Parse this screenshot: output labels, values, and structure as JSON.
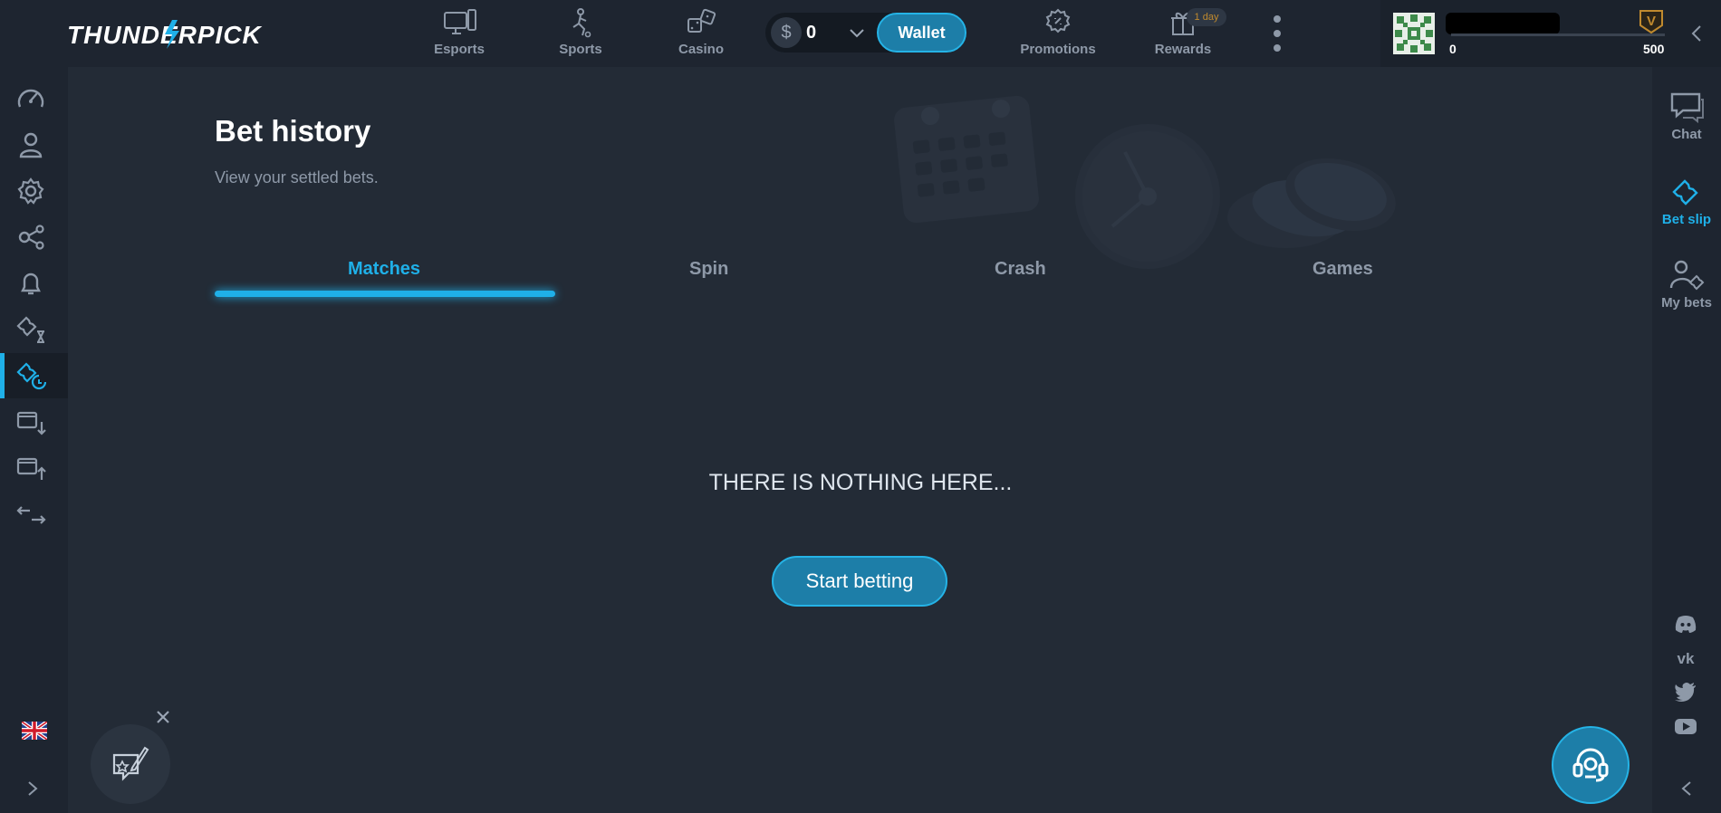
{
  "brand": {
    "logo_text": "THUNDERPICK"
  },
  "header": {
    "nav": [
      {
        "label": "Esports",
        "icon": "monitor-icon"
      },
      {
        "label": "Sports",
        "icon": "player-icon"
      },
      {
        "label": "Casino",
        "icon": "dice-icon"
      },
      {
        "label": "Promotions",
        "icon": "gear-badge-icon"
      },
      {
        "label": "Rewards",
        "icon": "gift-icon",
        "badge": "1 day"
      }
    ],
    "balance": {
      "currency_symbol": "$",
      "value": "0"
    },
    "wallet_label": "Wallet",
    "user": {
      "level_current": "0",
      "level_next": "500",
      "xp_progress": 0,
      "badge_letter": "V"
    }
  },
  "page": {
    "title": "Bet history",
    "subtitle": "View your settled bets.",
    "tabs": [
      {
        "label": "Matches",
        "active": true
      },
      {
        "label": "Spin",
        "active": false
      },
      {
        "label": "Crash",
        "active": false
      },
      {
        "label": "Games",
        "active": false
      }
    ],
    "empty_message": "THERE IS NOTHING HERE...",
    "cta_label": "Start betting"
  },
  "left_sidebar": {
    "items": [
      "dashboard-icon",
      "profile-icon",
      "settings-icon",
      "share-icon",
      "bell-icon",
      "ticket-pending-icon",
      "bet-history-icon",
      "deposit-icon",
      "withdraw-icon",
      "transfer-icon"
    ],
    "active": "bet-history-icon",
    "language": "en-gb"
  },
  "right_sidebar": {
    "items": [
      {
        "label": "Chat",
        "icon": "chat-icon"
      },
      {
        "label": "Bet slip",
        "icon": "ticket-icon",
        "active": true
      },
      {
        "label": "My bets",
        "icon": "my-bets-icon"
      }
    ],
    "socials": [
      "discord-icon",
      "vk-icon",
      "twitter-icon",
      "youtube-icon"
    ]
  },
  "colors": {
    "accent": "#1fb0e8",
    "button": "#1d7ea8",
    "bg": "#232b36",
    "rail": "#1e2530",
    "text_muted": "#8e99a8"
  }
}
